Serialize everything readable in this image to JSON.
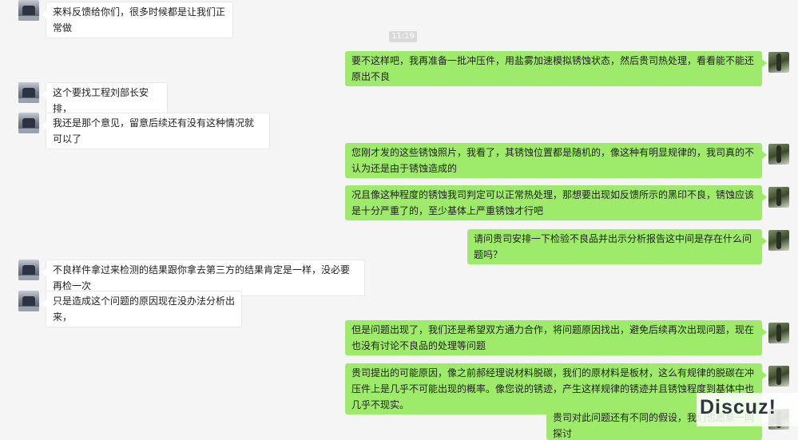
{
  "timestamp": "11:19",
  "messages": [
    {
      "side": "in",
      "text": "来料反馈给你们，很多时候都是让我们正常做"
    },
    {
      "side": "out",
      "text": "要不这样吧，我再准备一批冲压件，用盐雾加速模拟锈蚀状态，然后贵司热处理，看看能不能还原出不良"
    },
    {
      "side": "in",
      "text": "这个要找工程刘部长安排，"
    },
    {
      "side": "in",
      "text": "我还是那个意见，留意后续还有没有这种情况就可以了"
    },
    {
      "side": "out",
      "text": "您刚才发的这些锈蚀照片，我看了，其锈蚀位置都是随机的，像这种有明显规律的，我司真的不认为还是由于锈蚀造成的"
    },
    {
      "side": "out",
      "text": "况且像这种程度的锈蚀我司判定可以正常热处理，那想要出现如反馈所示的黑印不良，锈蚀应该是十分严重了的，至少基体上严重锈蚀才行吧"
    },
    {
      "side": "out",
      "text": "请问贵司安排一下检验不良品并出示分析报告这中间是存在什么问题吗？"
    },
    {
      "side": "in",
      "text": "不良样件拿过来检测的结果跟你拿去第三方的结果肯定是一样，没必要再检一次"
    },
    {
      "side": "in",
      "text": "只是造成这个问题的原因现在没办法分析出来，"
    },
    {
      "side": "out",
      "text": "但是问题出现了，我们还是希望双方通力合作，将问题原因找出，避免后续再次出现问题，现在也没有讨论不良品的处理等问题"
    },
    {
      "side": "out",
      "text": "贵司提出的可能原因，像之前郝经理说材料脱碳，我们的原材料是板材，这么有规律的脱碳在冲压件上是几乎不可能出现的概率。像您说的锈迹，产生这样规律的锈迹并且锈蚀程度到基体中也几乎不现实。"
    },
    {
      "side": "out",
      "text": "贵司对此问题还有不同的假设，我们也愿意一同探讨"
    }
  ],
  "watermark": "Discuz!"
}
